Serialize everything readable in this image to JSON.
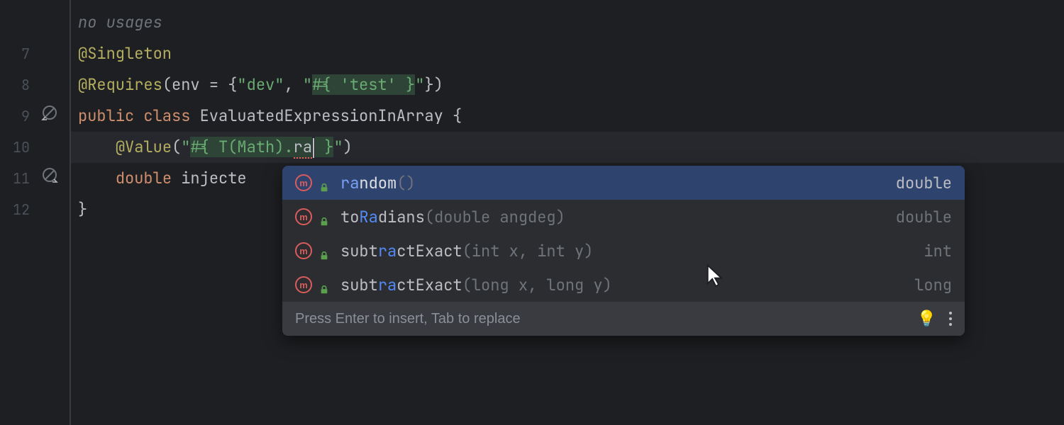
{
  "gutter": {
    "lines": [
      "",
      "7",
      "8",
      "9",
      "10",
      "11",
      "12"
    ]
  },
  "code": {
    "usages_hint": "no usages",
    "l7_annotation": "@Singleton",
    "l8_annotation": "@Requires",
    "l8_open": "(env = {",
    "l8_str1": "\"dev\"",
    "l8_comma": ", ",
    "l8_str2_open": "\"",
    "l8_expr": "#{ 'test' }",
    "l8_str2_close": "\"",
    "l8_close": "})",
    "l9_mod": "public class ",
    "l9_name": "EvaluatedExpressionInArray",
    "l9_brace": " {",
    "l10_indent": "    ",
    "l10_annotation": "@Value",
    "l10_open": "(",
    "l10_str_open": "\"",
    "l10_expr_pre": "#{ T(Math).",
    "l10_typed": "ra",
    "l10_expr_post": " }",
    "l10_str_close": "\"",
    "l10_close": ")",
    "l11_indent": "    ",
    "l11_type": "double ",
    "l11_name": "injecte",
    "l12_brace": "}"
  },
  "completion": {
    "items": [
      {
        "pre": "",
        "match": "ra",
        "post": "ndom",
        "params": "()",
        "ret": "double",
        "selected": true
      },
      {
        "pre": "to",
        "match": "Ra",
        "post": "dians",
        "params": "(double angdeg)",
        "ret": "double",
        "selected": false
      },
      {
        "pre": "subt",
        "match": "ra",
        "post": "ctExact",
        "params": "(int x, int y)",
        "ret": "int",
        "selected": false
      },
      {
        "pre": "subt",
        "match": "ra",
        "post": "ctExact",
        "params": "(long x, long y)",
        "ret": "long",
        "selected": false
      }
    ],
    "footer_hint": "Press Enter to insert, Tab to replace"
  }
}
